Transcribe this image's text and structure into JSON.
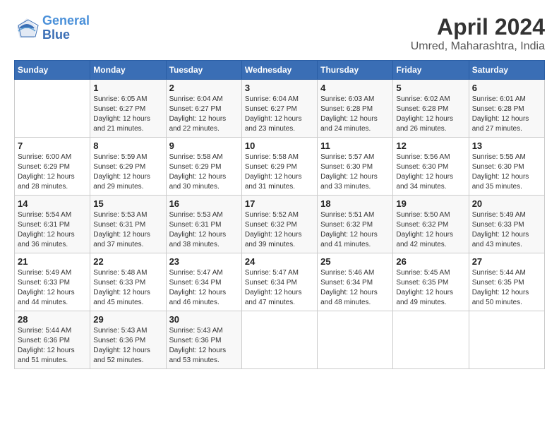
{
  "logo": {
    "line1": "General",
    "line2": "Blue"
  },
  "title": "April 2024",
  "subtitle": "Umred, Maharashtra, India",
  "weekdays": [
    "Sunday",
    "Monday",
    "Tuesday",
    "Wednesday",
    "Thursday",
    "Friday",
    "Saturday"
  ],
  "weeks": [
    [
      {
        "day": "",
        "info": ""
      },
      {
        "day": "1",
        "info": "Sunrise: 6:05 AM\nSunset: 6:27 PM\nDaylight: 12 hours\nand 21 minutes."
      },
      {
        "day": "2",
        "info": "Sunrise: 6:04 AM\nSunset: 6:27 PM\nDaylight: 12 hours\nand 22 minutes."
      },
      {
        "day": "3",
        "info": "Sunrise: 6:04 AM\nSunset: 6:27 PM\nDaylight: 12 hours\nand 23 minutes."
      },
      {
        "day": "4",
        "info": "Sunrise: 6:03 AM\nSunset: 6:28 PM\nDaylight: 12 hours\nand 24 minutes."
      },
      {
        "day": "5",
        "info": "Sunrise: 6:02 AM\nSunset: 6:28 PM\nDaylight: 12 hours\nand 26 minutes."
      },
      {
        "day": "6",
        "info": "Sunrise: 6:01 AM\nSunset: 6:28 PM\nDaylight: 12 hours\nand 27 minutes."
      }
    ],
    [
      {
        "day": "7",
        "info": "Sunrise: 6:00 AM\nSunset: 6:29 PM\nDaylight: 12 hours\nand 28 minutes."
      },
      {
        "day": "8",
        "info": "Sunrise: 5:59 AM\nSunset: 6:29 PM\nDaylight: 12 hours\nand 29 minutes."
      },
      {
        "day": "9",
        "info": "Sunrise: 5:58 AM\nSunset: 6:29 PM\nDaylight: 12 hours\nand 30 minutes."
      },
      {
        "day": "10",
        "info": "Sunrise: 5:58 AM\nSunset: 6:29 PM\nDaylight: 12 hours\nand 31 minutes."
      },
      {
        "day": "11",
        "info": "Sunrise: 5:57 AM\nSunset: 6:30 PM\nDaylight: 12 hours\nand 33 minutes."
      },
      {
        "day": "12",
        "info": "Sunrise: 5:56 AM\nSunset: 6:30 PM\nDaylight: 12 hours\nand 34 minutes."
      },
      {
        "day": "13",
        "info": "Sunrise: 5:55 AM\nSunset: 6:30 PM\nDaylight: 12 hours\nand 35 minutes."
      }
    ],
    [
      {
        "day": "14",
        "info": "Sunrise: 5:54 AM\nSunset: 6:31 PM\nDaylight: 12 hours\nand 36 minutes."
      },
      {
        "day": "15",
        "info": "Sunrise: 5:53 AM\nSunset: 6:31 PM\nDaylight: 12 hours\nand 37 minutes."
      },
      {
        "day": "16",
        "info": "Sunrise: 5:53 AM\nSunset: 6:31 PM\nDaylight: 12 hours\nand 38 minutes."
      },
      {
        "day": "17",
        "info": "Sunrise: 5:52 AM\nSunset: 6:32 PM\nDaylight: 12 hours\nand 39 minutes."
      },
      {
        "day": "18",
        "info": "Sunrise: 5:51 AM\nSunset: 6:32 PM\nDaylight: 12 hours\nand 41 minutes."
      },
      {
        "day": "19",
        "info": "Sunrise: 5:50 AM\nSunset: 6:32 PM\nDaylight: 12 hours\nand 42 minutes."
      },
      {
        "day": "20",
        "info": "Sunrise: 5:49 AM\nSunset: 6:33 PM\nDaylight: 12 hours\nand 43 minutes."
      }
    ],
    [
      {
        "day": "21",
        "info": "Sunrise: 5:49 AM\nSunset: 6:33 PM\nDaylight: 12 hours\nand 44 minutes."
      },
      {
        "day": "22",
        "info": "Sunrise: 5:48 AM\nSunset: 6:33 PM\nDaylight: 12 hours\nand 45 minutes."
      },
      {
        "day": "23",
        "info": "Sunrise: 5:47 AM\nSunset: 6:34 PM\nDaylight: 12 hours\nand 46 minutes."
      },
      {
        "day": "24",
        "info": "Sunrise: 5:47 AM\nSunset: 6:34 PM\nDaylight: 12 hours\nand 47 minutes."
      },
      {
        "day": "25",
        "info": "Sunrise: 5:46 AM\nSunset: 6:34 PM\nDaylight: 12 hours\nand 48 minutes."
      },
      {
        "day": "26",
        "info": "Sunrise: 5:45 AM\nSunset: 6:35 PM\nDaylight: 12 hours\nand 49 minutes."
      },
      {
        "day": "27",
        "info": "Sunrise: 5:44 AM\nSunset: 6:35 PM\nDaylight: 12 hours\nand 50 minutes."
      }
    ],
    [
      {
        "day": "28",
        "info": "Sunrise: 5:44 AM\nSunset: 6:36 PM\nDaylight: 12 hours\nand 51 minutes."
      },
      {
        "day": "29",
        "info": "Sunrise: 5:43 AM\nSunset: 6:36 PM\nDaylight: 12 hours\nand 52 minutes."
      },
      {
        "day": "30",
        "info": "Sunrise: 5:43 AM\nSunset: 6:36 PM\nDaylight: 12 hours\nand 53 minutes."
      },
      {
        "day": "",
        "info": ""
      },
      {
        "day": "",
        "info": ""
      },
      {
        "day": "",
        "info": ""
      },
      {
        "day": "",
        "info": ""
      }
    ]
  ]
}
